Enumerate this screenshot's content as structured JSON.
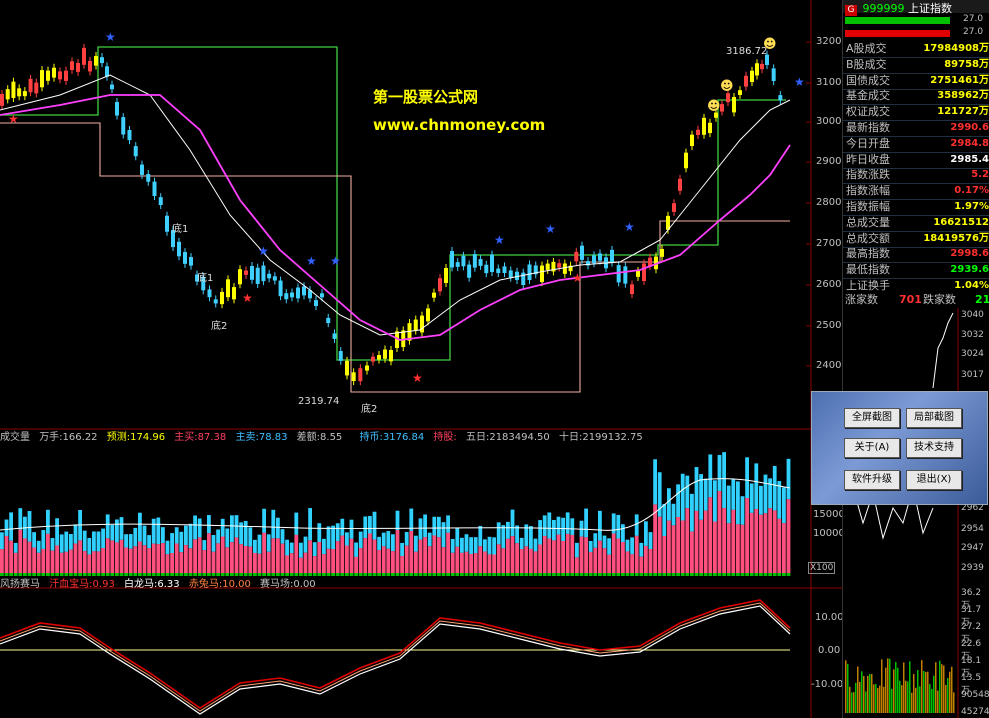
{
  "watermark": {
    "line1": "第一股票公式网",
    "line2": "www.chnmoney.com"
  },
  "main_chart": {
    "y_ticks": [
      "3200",
      "3100",
      "3000",
      "2900",
      "2800",
      "2700",
      "2600",
      "2500",
      "2400"
    ],
    "annotations": {
      "high": "3186.72",
      "low": "2319.74",
      "di1": "底1",
      "di2a": "底2",
      "di2b": "底2",
      "bottom_di2": "底2"
    }
  },
  "volume_bar": {
    "name": "成交量",
    "wan": "万手:166.22",
    "yuce": "预测:174.96",
    "zhumai": "主买:87.38",
    "zhumai2": "主卖:78.83",
    "chae": "差额:8.55",
    "chibi": "持币:3176.84",
    "chigu": "持股:",
    "five": "五日:2183494.50",
    "ten": "十日:2199132.75",
    "y_ticks": [
      "15000",
      "10000"
    ],
    "unit": "X100"
  },
  "osc_bar": {
    "name": "风扬赛马",
    "a": "汗血宝马:0.93",
    "b": "白龙马:6.33",
    "c": "赤兔马:10.00",
    "d": "赛马场:0.00",
    "y_ticks": [
      "10.00",
      "0.00",
      "-10.00"
    ]
  },
  "right_panel": {
    "title_code": "999999",
    "title_name": "上证指数",
    "g": "G",
    "bar_vals": [
      "27.0",
      "27.0"
    ],
    "rows": [
      {
        "label": "A股成交",
        "value": "17984908万",
        "color": "#ffff00"
      },
      {
        "label": "B股成交",
        "value": "89758万",
        "color": "#ffff00"
      },
      {
        "label": "国债成交",
        "value": "2751461万",
        "color": "#ffff00"
      },
      {
        "label": "基金成交",
        "value": "358962万",
        "color": "#ffff00"
      },
      {
        "label": "权证成交",
        "value": "121727万",
        "color": "#ffff00"
      },
      {
        "label": "最新指数",
        "value": "2990.6",
        "color": "#ff3030"
      },
      {
        "label": "今日开盘",
        "value": "2984.8",
        "color": "#ff3030"
      },
      {
        "label": "昨日收盘",
        "value": "2985.4",
        "color": "#ffffff"
      },
      {
        "label": "指数涨跌",
        "value": "5.2",
        "color": "#ff3030"
      },
      {
        "label": "指数涨幅",
        "value": "0.17%",
        "color": "#ff3030"
      },
      {
        "label": "指数振幅",
        "value": "1.97%",
        "color": "#ffff00"
      },
      {
        "label": "总成交量",
        "value": "16621512",
        "color": "#ffff00"
      },
      {
        "label": "总成交额",
        "value": "18419576万",
        "color": "#ffff00"
      },
      {
        "label": "最高指数",
        "value": "2998.6",
        "color": "#ff3030"
      },
      {
        "label": "最低指数",
        "value": "2939.6",
        "color": "#00ff00"
      },
      {
        "label": "上证换手",
        "value": "1.04%",
        "color": "#ffff00"
      }
    ],
    "updown": {
      "up_label": "涨家数",
      "up": "701",
      "down_label": "跌家数",
      "down": "21"
    },
    "mini_ticks": [
      "3040",
      "3032",
      "3024",
      "3017",
      "2962",
      "2954",
      "2947",
      "2939"
    ],
    "vol_ticks": [
      "36.2万",
      "31.7万",
      "27.2万",
      "22.6万",
      "18.1万",
      "13.5万",
      "90548",
      "45274"
    ]
  },
  "dialog": {
    "full_shot": "全屏截图",
    "part_shot": "局部截图",
    "about": "关于(A)",
    "support": "技术支持",
    "upgrade": "软件升级",
    "exit": "退出(X)"
  }
}
